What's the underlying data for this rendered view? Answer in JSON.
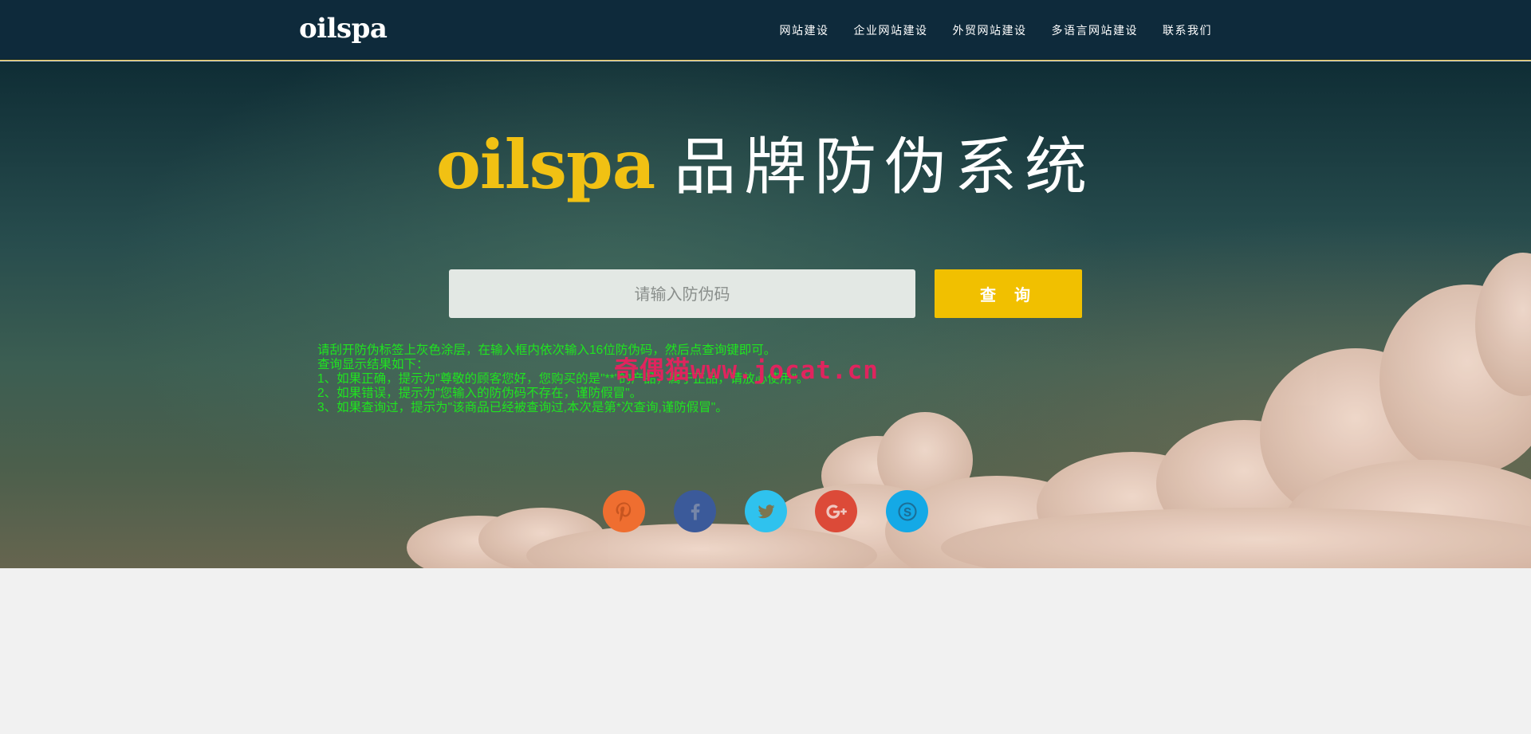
{
  "header": {
    "logo": "oilspa",
    "nav": [
      {
        "label": "网站建设"
      },
      {
        "label": "企业网站建设"
      },
      {
        "label": "外贸网站建设"
      },
      {
        "label": "多语言网站建设"
      },
      {
        "label": "联系我们"
      }
    ]
  },
  "hero": {
    "brand": "oilspa",
    "title": "品牌防伪系统"
  },
  "search": {
    "placeholder": "请输入防伪码",
    "button_label": "查 询"
  },
  "instructions": {
    "lines": [
      "请刮开防伪标签上灰色涂层，在输入框内依次输入16位防伪码，然后点查询键即可。",
      "查询显示结果如下：",
      "1、如果正确，提示为\"尊敬的顾客您好，您购买的是\"**\"的产品，属于正品，请放心使用\"。",
      "2、如果错误，提示为\"您输入的防伪码不存在，谨防假冒\"。",
      "3、如果查询过，提示为\"该商品已经被查询过,本次是第*次查询,谨防假冒\"。"
    ]
  },
  "watermark": "奇偶猫www.jocat.cn",
  "social": [
    {
      "icon": "pinterest-icon",
      "color": "#ef6e30"
    },
    {
      "icon": "facebook-icon",
      "color": "#3b5a9a"
    },
    {
      "icon": "twitter-icon",
      "color": "#2fc2ee"
    },
    {
      "icon": "google-plus-icon",
      "color": "#dc4a38"
    },
    {
      "icon": "skype-icon",
      "color": "#14a9e6"
    }
  ]
}
